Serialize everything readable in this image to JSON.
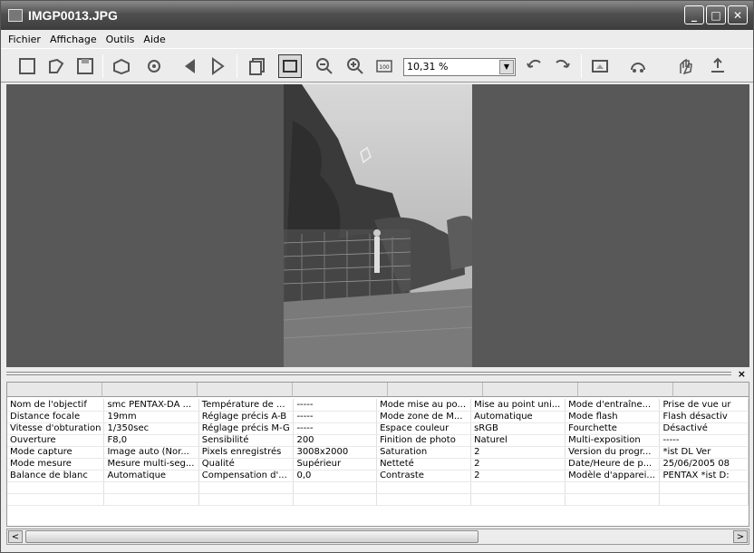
{
  "window": {
    "title": "IMGP0013.JPG"
  },
  "window_buttons": {
    "minimize": "_",
    "maximize": "□",
    "close": "✕"
  },
  "menu": [
    "Fichier",
    "Affichage",
    "Outils",
    "Aide"
  ],
  "toolbar": {
    "zoom_value": "10,31 %",
    "icons": [
      "new-window-icon",
      "edit-icon",
      "save-icon",
      "print-icon",
      "settings-icon",
      "previous-icon",
      "next-icon",
      "copy-icon",
      "fit-window-icon",
      "zoom-out-icon",
      "zoom-in-icon",
      "actual-size-icon",
      "rotate-left-icon",
      "rotate-right-icon",
      "display-mode-icon",
      "slideshow-icon",
      "protect-icon",
      "upload-icon"
    ]
  },
  "info_rows": [
    [
      "Nom de l'objectif",
      "smc PENTAX-DA ...",
      "Température de ...",
      "-----",
      "Mode mise au po...",
      "Mise au point uni...",
      "Mode d'entraîne...",
      "Prise de vue ur"
    ],
    [
      "Distance focale",
      "19mm",
      "Réglage précis A-B",
      "-----",
      "Mode zone de M...",
      "Automatique",
      "Mode flash",
      "Flash désactiv"
    ],
    [
      "Vitesse d'obturation",
      "1/350sec",
      "Réglage précis M-G",
      "-----",
      "Espace couleur",
      "sRGB",
      "Fourchette",
      "Désactivé"
    ],
    [
      "Ouverture",
      "F8,0",
      "Sensibilité",
      "200",
      "Finition de photo",
      "Naturel",
      "Multi-exposition",
      "-----"
    ],
    [
      "Mode capture",
      "Image auto (Nor...",
      "Pixels enregistrés",
      "3008x2000",
      "Saturation",
      "2",
      "Version du progr...",
      "*ist DL   Ver"
    ],
    [
      "Mode mesure",
      "Mesure multi-seg...",
      "Qualité",
      "Supérieur",
      "Netteté",
      "2",
      "Date/Heure de p...",
      "25/06/2005 08"
    ],
    [
      "Balance de blanc",
      "Automatique",
      "Compensation d'...",
      "0,0",
      "Contraste",
      "2",
      "Modèle d'apparei...",
      "PENTAX *ist D:"
    ],
    [
      "",
      "",
      "",
      "",
      "",
      "",
      "",
      ""
    ],
    [
      "",
      "",
      "",
      "",
      "",
      "",
      "",
      ""
    ]
  ],
  "panel": {
    "close": "×"
  },
  "scrollbar": {
    "left": "<",
    "right": ">"
  }
}
